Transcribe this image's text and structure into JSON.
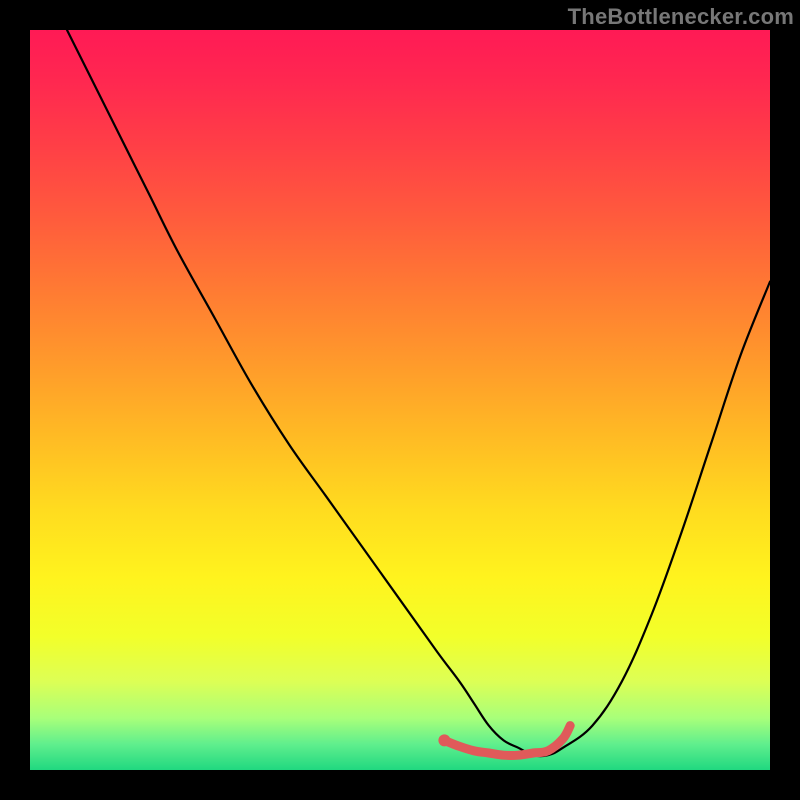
{
  "watermark": "TheBottlenecker.com",
  "gradient": {
    "stops": [
      {
        "offset": 0.0,
        "color": "#ff1a55"
      },
      {
        "offset": 0.07,
        "color": "#ff2850"
      },
      {
        "offset": 0.15,
        "color": "#ff3d47"
      },
      {
        "offset": 0.25,
        "color": "#ff5a3d"
      },
      {
        "offset": 0.35,
        "color": "#ff7a33"
      },
      {
        "offset": 0.45,
        "color": "#ff9a2b"
      },
      {
        "offset": 0.55,
        "color": "#ffbb24"
      },
      {
        "offset": 0.65,
        "color": "#ffdc1f"
      },
      {
        "offset": 0.74,
        "color": "#fff31e"
      },
      {
        "offset": 0.82,
        "color": "#f2ff2a"
      },
      {
        "offset": 0.88,
        "color": "#ddff55"
      },
      {
        "offset": 0.93,
        "color": "#a8ff7a"
      },
      {
        "offset": 0.965,
        "color": "#60ef8d"
      },
      {
        "offset": 1.0,
        "color": "#20d880"
      }
    ]
  },
  "chart_data": {
    "type": "line",
    "title": "",
    "xlabel": "",
    "ylabel": "",
    "xlim": [
      0,
      100
    ],
    "ylim": [
      0,
      100
    ],
    "series": [
      {
        "name": "bottleneck-curve",
        "color": "#000000",
        "width": 2.2,
        "x": [
          5,
          8,
          12,
          16,
          20,
          25,
          30,
          35,
          40,
          45,
          50,
          55,
          58,
          60,
          62,
          64,
          66,
          68,
          70,
          72,
          76,
          80,
          84,
          88,
          92,
          96,
          100
        ],
        "y": [
          100,
          94,
          86,
          78,
          70,
          61,
          52,
          44,
          37,
          30,
          23,
          16,
          12,
          9,
          6,
          4,
          3,
          2,
          2,
          3,
          6,
          12,
          21,
          32,
          44,
          56,
          66
        ]
      },
      {
        "name": "optimal-band",
        "color": "#e05a5a",
        "width": 9,
        "x": [
          56,
          58,
          60,
          62,
          64,
          66,
          68,
          70,
          72,
          73
        ],
        "y": [
          4.0,
          3.2,
          2.6,
          2.3,
          2.0,
          2.0,
          2.3,
          2.6,
          4.2,
          6.0
        ]
      },
      {
        "name": "optimal-start-dot",
        "type": "scatter",
        "color": "#e05a5a",
        "size": 12,
        "x": [
          56
        ],
        "y": [
          4.0
        ]
      }
    ]
  }
}
